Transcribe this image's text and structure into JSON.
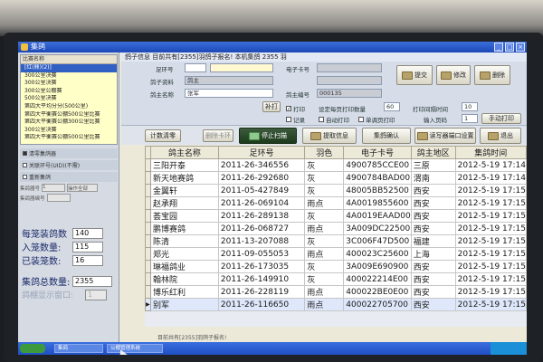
{
  "window": {
    "title": "集鸽"
  },
  "info_bar": "鸽子信息  目前共有[2355]羽鸽子报名!  本机集鸽 2355 羽",
  "competition_list": {
    "header": "比赛名称",
    "items": [
      "[红(鼎)(2)]",
      "300公里决赛",
      "300公里决赛",
      "300公里公棚赛",
      "500公里决赛",
      "第四大平均分分(500公里)",
      "第四大平衡赛公棚500公里比赛",
      "第四大平衡赛公棚300公里比赛",
      "300公里决赛",
      "第四大平衡赛公棚500公里比赛"
    ],
    "selected_index": 0
  },
  "options": [
    {
      "label": "清零集鸽器",
      "on": true
    },
    {
      "label": "关联环号(UID)(不需)",
      "on": false
    },
    {
      "label": "重新集鸽",
      "on": false
    }
  ],
  "mini_row": {
    "label": "集鸽器号",
    "value": "1",
    "button": "操作全部"
  },
  "mini_row2": {
    "label": "集鸽器编号"
  },
  "stats": [
    {
      "label": "每笼装鸽数",
      "value": "140"
    },
    {
      "label": "入笼数量:",
      "value": "115"
    },
    {
      "label": "已装笼数:",
      "value": "16"
    },
    {
      "label": "集鸽总数量:",
      "value": "2355"
    },
    {
      "label": "鸽棚显示窗口:",
      "value": "1"
    }
  ],
  "form": {
    "foot_ring_label": "足环号",
    "owner_info_label": "鸽子资料",
    "owner_name_label": "鸽主名称",
    "owner_name_value": "张军",
    "owner_data_value": "鸽主",
    "electronic_ring_label": "电子卡号",
    "club_code_label": "鸽主编号",
    "club_code_value": "000135",
    "add_btn": "补打",
    "check_print": "打印",
    "check_log": "记录",
    "set_print_count_label": "设定每页打印数量",
    "print_count": "60",
    "print_interval_label": "打印间隔时间",
    "print_interval": "10",
    "input_page_label": "输入页码",
    "input_page": "1",
    "auto_print": "自动打印",
    "single_print": "单调页打印",
    "btn_submit": "提交",
    "btn_modify": "修改",
    "btn_delete": "删除",
    "btn_manual_print": "手动打印"
  },
  "toolbar": {
    "calc_clear": "计数清零",
    "scan_card": "删除卡环",
    "stop_scan": "停止扫描",
    "get_info": "提取信息",
    "confirm_collect": "集鸽确认",
    "port_setup": "读写器端口设置",
    "exit": "退出"
  },
  "table": {
    "columns": [
      "鸽主名称",
      "足环号",
      "羽色",
      "电子卡号",
      "鸽主地区",
      "集鸽时间"
    ],
    "rows": [
      [
        "三阳开泰",
        "2011-26-346556",
        "灰",
        "4900785CCE00",
        "三原",
        "2012-5-19 17:14"
      ],
      [
        "新天地赛鸽",
        "2011-26-292680",
        "灰",
        "4900784BAD00",
        "渭南",
        "2012-5-19 17:14"
      ],
      [
        "金翼轩",
        "2011-05-427849",
        "灰",
        "48005BB52500",
        "西安",
        "2012-5-19 17:15"
      ],
      [
        "赵承翔",
        "2011-26-069104",
        "雨点",
        "4A0019855600",
        "西安",
        "2012-5-19 17:15"
      ],
      [
        "荟宝园",
        "2011-26-289138",
        "灰",
        "4A0019EAAD00",
        "西安",
        "2012-5-19 17:15"
      ],
      [
        "鹏博赛鸽",
        "2011-26-068727",
        "雨点",
        "3A009DC22500",
        "西安",
        "2012-5-19 17:15"
      ],
      [
        "陈清",
        "2011-13-207088",
        "灰",
        "3C006F47D500",
        "福建",
        "2012-5-19 17:15"
      ],
      [
        "郑光",
        "2011-09-055053",
        "雨点",
        "400023C25600",
        "上海",
        "2012-5-19 17:15"
      ],
      [
        "琳福鸽业",
        "2011-26-173035",
        "灰",
        "3A009E690900",
        "西安",
        "2012-5-19 17:15"
      ],
      [
        "翰林院",
        "2011-26-149910",
        "灰",
        "400022214E00",
        "西安",
        "2012-5-19 17:15"
      ],
      [
        "博乐红利",
        "2011-26-228119",
        "雨点",
        "400022BE0E00",
        "西安",
        "2012-5-19 17:15"
      ],
      [
        "别军",
        "2011-26-116650",
        "雨点",
        "400022705700",
        "西安",
        "2012-5-19 17:15"
      ]
    ],
    "selected_row": 11
  },
  "status_bar": "目前共有[2355]羽鸽子报名!",
  "taskbar": {
    "items": [
      "集鸽",
      "公棚管理系统"
    ]
  }
}
